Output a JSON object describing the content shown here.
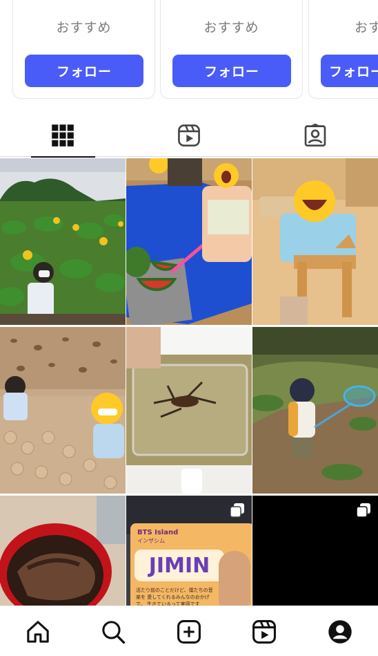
{
  "suggestions": [
    {
      "label": "おすすめ",
      "follow_label": "フォロー"
    },
    {
      "label": "おすすめ",
      "follow_label": "フォロー"
    },
    {
      "label": "おすすめ",
      "follow_label": "フォロー"
    }
  ],
  "tabs": [
    {
      "icon": "grid-icon",
      "active": true
    },
    {
      "icon": "reels-icon",
      "active": false
    },
    {
      "icon": "tagged-icon",
      "active": false
    }
  ],
  "posts": [
    {
      "subject": "sunflower-field"
    },
    {
      "subject": "watermelon-play"
    },
    {
      "subject": "wooden-horse"
    },
    {
      "subject": "ball-pit"
    },
    {
      "subject": "crayfish-container"
    },
    {
      "subject": "bug-net-forest"
    },
    {
      "subject": "grilled-fish-bowl"
    },
    {
      "subject": "poster",
      "multiple": true
    },
    {
      "subject": "black-video",
      "multiple": true
    }
  ],
  "poster": {
    "title": "JIMIN",
    "logo": "BTS Island",
    "logo_sub": "インザシム",
    "caption": "活たり前のことだけど、僕たちの音楽を 愛してくれるみんなのおかげで、 生きているって実感です"
  },
  "bottom_nav": [
    {
      "icon": "home-icon"
    },
    {
      "icon": "search-icon"
    },
    {
      "icon": "create-icon"
    },
    {
      "icon": "reels-icon"
    },
    {
      "icon": "profile-icon"
    }
  ],
  "colors": {
    "accent": "#4a5cf7",
    "text_muted": "#7a7a7a"
  }
}
